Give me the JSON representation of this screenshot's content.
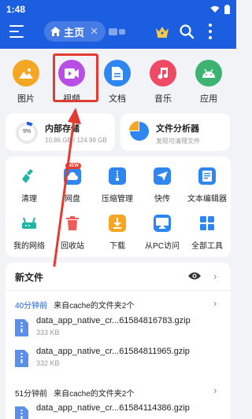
{
  "status": {
    "time": "1:48"
  },
  "toolbar": {
    "home_tab_label": "主页",
    "home_tab_close": "✕"
  },
  "categories": [
    {
      "label": "图片",
      "icon": "image-icon",
      "color": "#f5a623"
    },
    {
      "label": "视频",
      "icon": "video-icon",
      "color": "#b84ee6"
    },
    {
      "label": "文档",
      "icon": "document-icon",
      "color": "#2e86f0"
    },
    {
      "label": "音乐",
      "icon": "music-icon",
      "color": "#ee4a64"
    },
    {
      "label": "应用",
      "icon": "android-icon",
      "color": "#3cb371"
    }
  ],
  "storage": {
    "internal": {
      "title": "内部存储",
      "sub": "10.86 GB / 124.99 GB",
      "percent_label": "9%"
    },
    "analyzer": {
      "title": "文件分析器",
      "sub": "发现可清理文件"
    }
  },
  "tools": [
    {
      "label": "清理",
      "icon": "broom-icon",
      "color": "#1fb5a5"
    },
    {
      "label": "网盘",
      "icon": "cloud-icon",
      "color": "#2e86f0",
      "badge": "NEW"
    },
    {
      "label": "压缩管理",
      "icon": "zip-icon",
      "color": "#2e86f0"
    },
    {
      "label": "快传",
      "icon": "send-icon",
      "color": "#2e86f0"
    },
    {
      "label": "文本编辑器",
      "icon": "text-editor-icon",
      "color": "#2e86f0"
    },
    {
      "label": "我的网络",
      "icon": "router-icon",
      "color": "#1fb5a5"
    },
    {
      "label": "回收站",
      "icon": "trash-icon",
      "color": "#ef5a5a"
    },
    {
      "label": "下载",
      "icon": "download-icon",
      "color": "#f5a623"
    },
    {
      "label": "从PC访问",
      "icon": "monitor-icon",
      "color": "#2e86f0"
    },
    {
      "label": "全部工具",
      "icon": "grid-icon",
      "color": "#2e86f0"
    }
  ],
  "new_files": {
    "title": "新文件",
    "groups": [
      {
        "time": "40分钟前",
        "desc": "来自cache的文件夹2个",
        "files": [
          {
            "name": "data_app_native_cr...61584816783.gzip",
            "size": "333 KB"
          },
          {
            "name": "data_app_native_cr...61584811965.gzip",
            "size": "332 KB"
          }
        ]
      },
      {
        "time": "51分钟前",
        "desc": "来自cache的文件夹2个",
        "files": [
          {
            "name": "data_app_native_cr...61584114386.gzip",
            "size": ""
          }
        ]
      }
    ]
  },
  "colors": {
    "primary": "#1b5fe0",
    "highlight": "#e23b32"
  }
}
